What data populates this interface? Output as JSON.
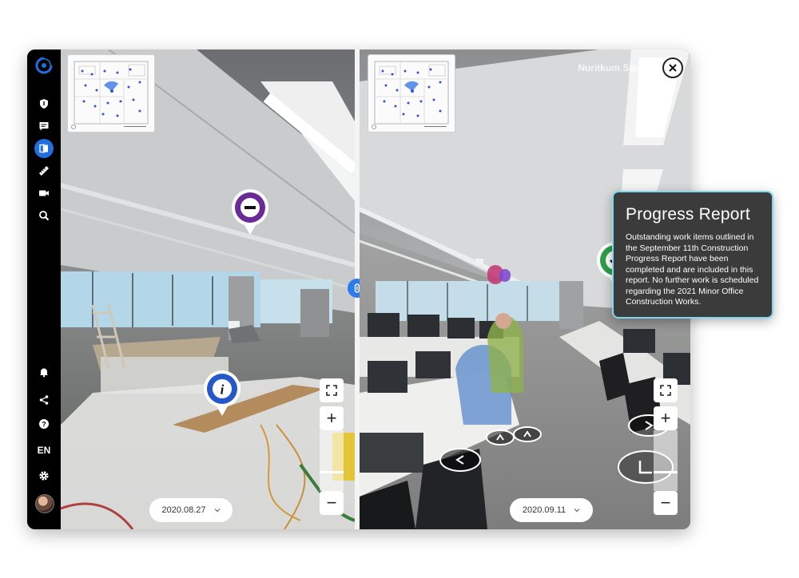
{
  "sidebar": {
    "items": [
      {
        "name": "shield-icon"
      },
      {
        "name": "comment-icon"
      },
      {
        "name": "compare-icon",
        "active": true
      },
      {
        "name": "ruler-icon"
      },
      {
        "name": "video-icon"
      },
      {
        "name": "search-icon"
      }
    ],
    "bottom_items": [
      {
        "name": "bell-icon"
      },
      {
        "name": "share-icon"
      },
      {
        "name": "help-icon"
      }
    ],
    "language": "EN"
  },
  "left_view": {
    "date": "2020.08.27",
    "pins": [
      {
        "type": "minus",
        "color": "#6a2a97"
      },
      {
        "type": "info",
        "color": "#2559c9"
      }
    ],
    "zoom_level": 0.7
  },
  "right_view": {
    "date": "2020.09.11",
    "location": "Nuritkum Square",
    "pins": [
      {
        "type": "check",
        "color": "#2e9e47"
      }
    ],
    "zoom_level": 0.7
  },
  "report": {
    "title": "Progress Report",
    "body": "Outstanding work items outlined in the September 11th Construction Progress Report have been completed and are included in this report. No further work is scheduled regarding the 2021 Minor Office Construction Works."
  },
  "colors": {
    "accent": "#1f6fe0",
    "card_border": "#7fd6ef",
    "card_bg": "#3b3b3b"
  }
}
